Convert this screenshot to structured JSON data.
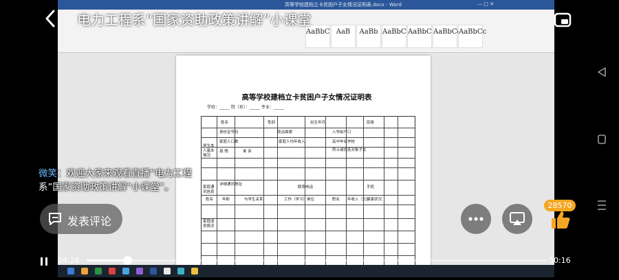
{
  "header": {
    "title": "电力工程系“国家资助政策讲解”小课堂"
  },
  "icons": {
    "back": "back-arrow-icon",
    "pip": "picture-in-picture-icon",
    "more": "more-dots-icon",
    "cast": "cast-screen-icon",
    "like": "thumbs-up-icon",
    "comment": "comment-bubble-icon",
    "play": "pause-icon",
    "nav_back": "nav-back-icon",
    "nav_home": "nav-home-icon",
    "nav_menu": "nav-menu-icon"
  },
  "video": {
    "document_title": "高等学校建档立卡贫困户子女情况证明表",
    "document_subtitle": "学校：_____ 院（系）：_____ 专业：_____",
    "ribbon_styles": [
      "AaBbC",
      "AaB",
      "AaBb",
      "AaBbC",
      "AaBbC",
      "AaBbCc",
      "AaBbCc"
    ],
    "form_labels": [
      "学生本人基本情况",
      "姓名",
      "性别",
      "出生年月",
      "民族",
      "身份证号码",
      "政治面貌",
      "入学前户口",
      "家庭人口数",
      "家庭人均年收入",
      "高中毕业学校",
      "孤 残",
      "单 亲",
      "烈士或优抚对象子女",
      "家庭通讯信息",
      "详细通讯地址",
      "联系电话",
      "手机",
      "家庭成员情况",
      "姓名",
      "年龄",
      "与学生关系",
      "工作（学习）单位",
      "职业",
      "年收入（元）",
      "健康状况"
    ]
  },
  "live_comment": {
    "name": "微笑",
    "text": "：欢迎大家来观看直播“电力工程系”国家资助政策讲解“小课堂”。"
  },
  "comment_button": {
    "label": "发表评论"
  },
  "like": {
    "count": "28570"
  },
  "player": {
    "current_time": "04:26",
    "total_time": "50:16",
    "progress": 0.088
  },
  "colors": {
    "word_blue": "#2b579a",
    "badge_orange": "#f5a623",
    "accent_like": "#f5a623"
  }
}
